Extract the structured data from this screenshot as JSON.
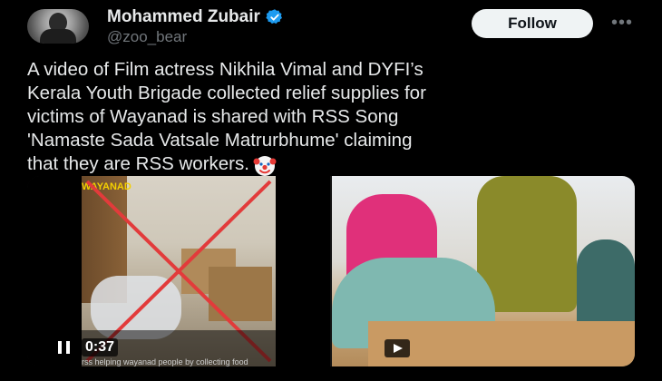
{
  "author": {
    "name": "Mohammed Zubair",
    "handle": "@zoo_bear",
    "verified": true,
    "verified_color": "#1d9bf0"
  },
  "actions": {
    "follow_label": "Follow",
    "more_icon": "more-horizontal-icon"
  },
  "tweet": {
    "lines": [
      "A video of Film actress Nikhila Vimal and DYFI’s",
      "Kerala Youth Brigade collected relief supplies for",
      "victims of Wayanad is shared with RSS Song",
      "'Namaste Sada Vatsale Matrurbhume' claiming",
      "that they are RSS workers."
    ],
    "emoji": "clown-face-icon"
  },
  "media": {
    "left_video": {
      "time": "0:37",
      "overlay_text": "WAYANAD",
      "caption": "rss helping wayanad people by collecting food"
    },
    "right_video": {
      "play_icon": "play-icon"
    }
  },
  "colors": {
    "background": "#000000",
    "text": "#e7e9ea",
    "muted": "#71767b",
    "x_mark": "#e23b3b"
  }
}
